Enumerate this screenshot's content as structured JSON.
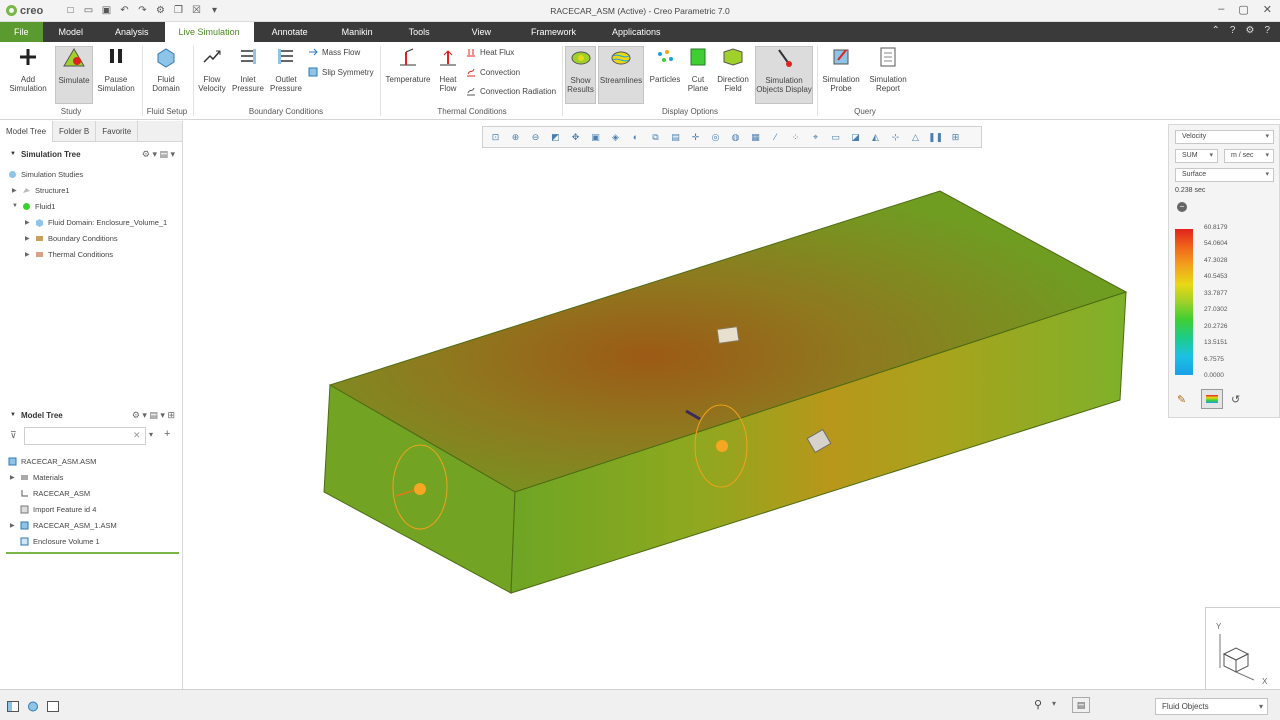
{
  "app": {
    "logo_text": "creo",
    "window_title": "RACECAR_ASM (Active) - Creo Parametric 7.0"
  },
  "quick_access": [
    "new-icon",
    "open-icon",
    "save-icon",
    "undo-icon",
    "redo-icon",
    "regenerate-icon",
    "windows-icon",
    "close-window-icon"
  ],
  "menu_tabs": [
    "File",
    "Model",
    "Analysis",
    "Live Simulation",
    "Annotate",
    "Manikin",
    "Tools",
    "View",
    "Framework",
    "Applications"
  ],
  "active_tab": "Live Simulation",
  "ribbon": {
    "add_simulation": "Add Simulation",
    "simulate": "Simulate",
    "pause_simulation": "Pause Simulation",
    "study_group": "Study",
    "fluid_domain": "Fluid Domain",
    "fluid_setup_group": "Fluid Setup",
    "flow_velocity": "Flow Velocity",
    "inlet_pressure": "Inlet Pressure",
    "outlet_pressure": "Outlet Pressure",
    "mass_flow": "Mass Flow",
    "slip_symmetry": "Slip Symmetry",
    "boundary_group": "Boundary Conditions",
    "temperature": "Temperature",
    "heat_flow": "Heat Flow",
    "heat_flux": "Heat Flux",
    "convection": "Convection",
    "convection_radiation": "Convection Radiation",
    "thermal_group": "Thermal Conditions",
    "show_results": "Show Results",
    "streamlines": "Streamlines",
    "particles": "Particles",
    "cut_plane": "Cut Plane",
    "direction_field": "Direction Field",
    "sim_objects_display": "Simulation Objects Display",
    "display_group": "Display Options",
    "simulation_probe": "Simulation Probe",
    "simulation_report": "Simulation Report",
    "query_group": "Query"
  },
  "left_tabs": [
    "Model Tree",
    "Folder B",
    "Favorite"
  ],
  "simulation_tree": {
    "title": "Simulation Tree",
    "items": [
      "Simulation Studies",
      "Structure1",
      "Fluid1",
      "Fluid Domain: Enclosure_Volume_1",
      "Boundary Conditions",
      "Thermal Conditions"
    ]
  },
  "model_tree": {
    "title": "Model Tree",
    "filter_placeholder": "",
    "items": [
      "RACECAR_ASM.ASM",
      "Materials",
      "RACECAR_ASM",
      "Import Feature id 4",
      "RACECAR_ASM_1.ASM",
      "Enclosure Volume 1"
    ]
  },
  "legend": {
    "quantity": "Velocity",
    "component": "SUM",
    "unit": "m / sec",
    "display": "Surface",
    "time": "0.238 sec",
    "values": [
      "60.8179",
      "54.0604",
      "47.3028",
      "40.5453",
      "33.7877",
      "27.0302",
      "20.2726",
      "13.5151",
      "6.7575",
      "0.0000"
    ],
    "colors": [
      "#e0231c",
      "#f0641a",
      "#f2a21c",
      "#e9d816",
      "#9fd12a",
      "#3fcf32",
      "#1dcc8c",
      "#1cc1e2",
      "#1aa0e8"
    ]
  },
  "triad_labels": [
    "Y",
    "X"
  ],
  "status": {
    "fluid_objects": "Fluid Objects"
  }
}
